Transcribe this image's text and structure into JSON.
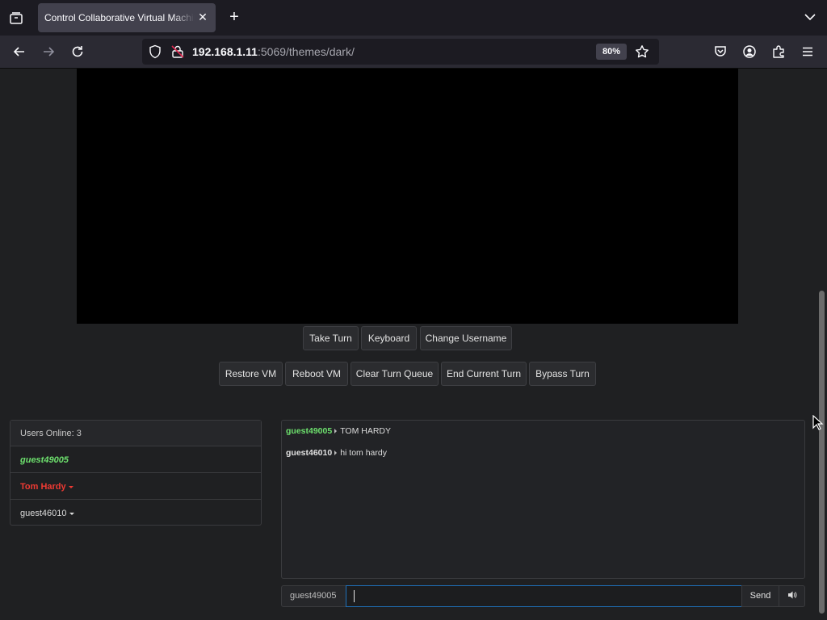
{
  "browser": {
    "tab_title": "Control Collaborative Virtual Machine",
    "url_host": "192.168.1.11",
    "url_rest": ":5069/themes/dark/",
    "zoom": "80%"
  },
  "vm_controls": {
    "row1": [
      "Take Turn",
      "Keyboard",
      "Change Username"
    ],
    "row2": [
      "Restore VM",
      "Reboot VM",
      "Clear Turn Queue",
      "End Current Turn",
      "Bypass Turn"
    ]
  },
  "users": {
    "header": "Users Online: 3",
    "list": [
      {
        "name": "guest49005",
        "status": "self"
      },
      {
        "name": "Tom Hardy",
        "status": "turn"
      },
      {
        "name": "guest46010",
        "status": "normal"
      }
    ]
  },
  "chat": {
    "messages": [
      {
        "user": "guest49005",
        "text": "TOM HARDY"
      },
      {
        "user": "guest46010",
        "text": "hi tom hardy"
      }
    ],
    "username": "guest49005",
    "input_value": "",
    "send_label": "Send"
  },
  "colors": {
    "self_user": "#6de06d",
    "turn_user": "#ee3a33",
    "focus_border": "#1f6fb7"
  }
}
